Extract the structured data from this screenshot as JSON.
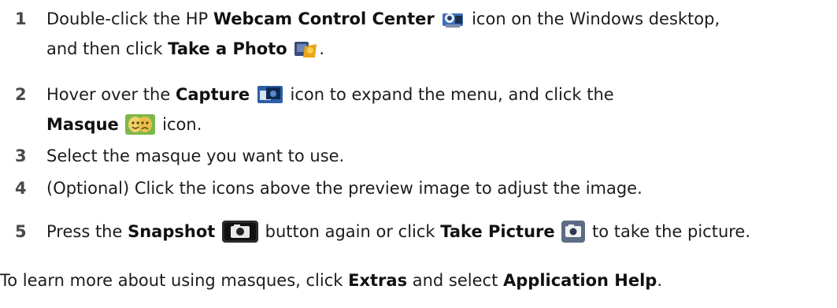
{
  "steps": [
    {
      "number": "1",
      "line1_a": "Double-click the HP ",
      "line1_b": "Webcam Control Center",
      "line1_icon": "webcam-control-center-icon",
      "line1_c": " icon on the Windows desktop,",
      "line2_a": "and then click ",
      "line2_b": "Take a Photo",
      "line2_icon": "take-a-photo-icon",
      "line2_c": "."
    },
    {
      "number": "2",
      "line1_a": "Hover over the ",
      "line1_b": "Capture",
      "line1_icon": "capture-icon",
      "line1_c": " icon to expand the menu, and click the",
      "line2_b": "Masque",
      "line2_icon": "masque-icon",
      "line2_c": " icon."
    },
    {
      "number": "3",
      "text": "Select the masque you want to use."
    },
    {
      "number": "4",
      "text": "(Optional) Click the icons above the preview image to adjust the image."
    },
    {
      "number": "5",
      "a": "Press the ",
      "b": "Snapshot",
      "b_icon": "snapshot-button-icon",
      "c": " button again or click ",
      "d": "Take Picture",
      "d_icon": "take-picture-icon",
      "e": " to take the picture."
    }
  ],
  "footer": {
    "a": "To learn more about using masques, click ",
    "b": "Extras",
    "c": " and select ",
    "d": "Application Help",
    "e": "."
  }
}
